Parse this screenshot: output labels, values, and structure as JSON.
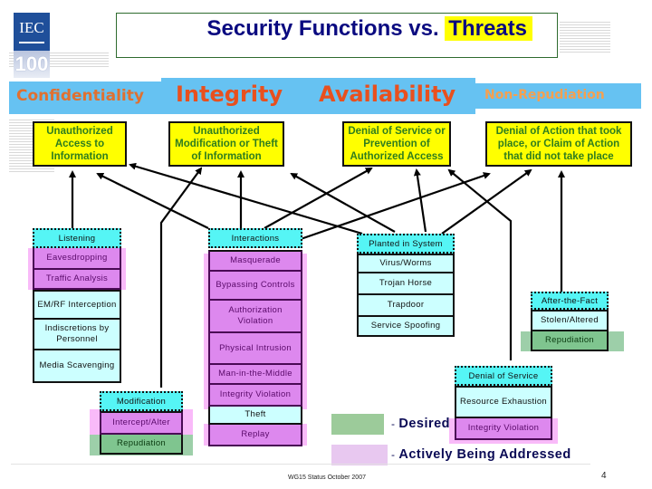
{
  "logo": {
    "org": "IEC",
    "anniversary": "100"
  },
  "title": {
    "prefix": "Security Functions vs.",
    "highlight": "Threats"
  },
  "categories": [
    {
      "label": "Confidentiality"
    },
    {
      "label": "Integrity"
    },
    {
      "label": "Availability"
    },
    {
      "label": "Non-Repudiation"
    }
  ],
  "threats": [
    {
      "label": "Unauthorized Access to Information"
    },
    {
      "label": "Unauthorized Modification or Theft of Information"
    },
    {
      "label": "Denial of Service or Prevention of Authorized Access"
    },
    {
      "label": "Denial of Action that took place, or Claim of Action that did not take place"
    }
  ],
  "stacks": {
    "listening": {
      "head": "Listening",
      "items": [
        "Eavesdropping",
        "Traffic Analysis",
        "EM/RF Interception",
        "Indiscretions by Personnel",
        "Media Scavenging"
      ]
    },
    "interactions": {
      "head": "Interactions",
      "items": [
        "Masquerade",
        "Bypassing Controls",
        "Authorization Violation",
        "Physical Intrusion",
        "Man-in-the-Middle",
        "Integrity Violation",
        "Theft",
        "Replay"
      ]
    },
    "planted": {
      "head": "Planted in System",
      "items": [
        "Virus/Worms",
        "Trojan Horse",
        "Trapdoor",
        "Service Spoofing"
      ]
    },
    "after_fact": {
      "head": "After-the-Fact",
      "items": [
        "Stolen/Altered",
        "Repudiation"
      ]
    },
    "dos": {
      "head": "Denial of Service",
      "items": [
        "Resource Exhaustion",
        "Integrity Violation"
      ]
    },
    "modification": {
      "head": "Modification",
      "items": [
        "Intercept/Alter",
        "Repudiation"
      ]
    }
  },
  "legend": [
    {
      "label": "Desired",
      "color": "#9ccb9a"
    },
    {
      "label": "Actively Being Addressed",
      "color": "#e8c8f0"
    }
  ],
  "colors": {
    "threat_box": "#ffff00",
    "category_band": "#66c2f2",
    "category_text": "#e8501e",
    "stack_head": "#55f5f5",
    "stack_cell": "#ccffff",
    "addressed": "#dd88ee",
    "desired": "#7fc58f"
  },
  "footer": {
    "text": "WG15 Status October 2007",
    "page": "4"
  }
}
